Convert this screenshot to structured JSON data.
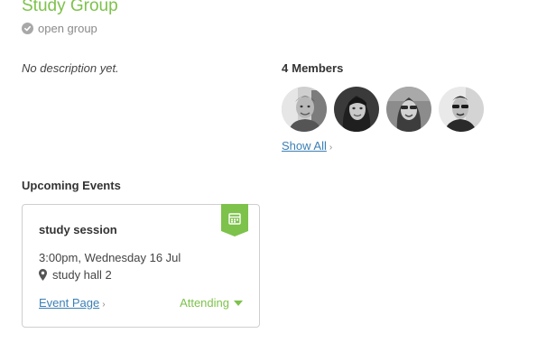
{
  "group": {
    "title": "Study Group",
    "type_label": "open group",
    "description": "No description yet."
  },
  "members": {
    "count_label": "4",
    "heading_label": "Members",
    "show_all_label": "Show All",
    "avatars": [
      "member-avatar-1",
      "member-avatar-2",
      "member-avatar-3",
      "member-avatar-4"
    ]
  },
  "events": {
    "heading": "Upcoming Events",
    "items": [
      {
        "title": "study session",
        "time": "3:00pm, Wednesday 16 Jul",
        "location": "study hall 2",
        "page_link": "Event Page",
        "rsvp": "Attending"
      }
    ]
  },
  "colors": {
    "brand_green": "#7dc24b",
    "link_blue": "#3b7fb5",
    "muted_gray": "#8a8a8a"
  },
  "icons": [
    "check-circle-icon",
    "calendar-icon",
    "map-pin-icon",
    "chevron-right-icon",
    "caret-down-icon"
  ]
}
